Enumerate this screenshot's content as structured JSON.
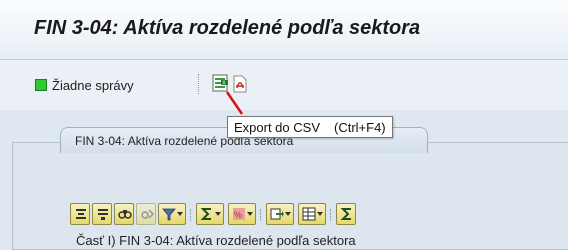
{
  "window": {
    "title": "FIN 3-04: Aktíva rozdelené podľa sektora"
  },
  "toolbar": {
    "status_label": "Žiadne správy",
    "status_color": "#32c832",
    "icons": [
      "export-csv-icon",
      "export-pdf-icon"
    ]
  },
  "tooltip": {
    "label": "Export do CSV",
    "shortcut": "(Ctrl+F4)"
  },
  "tab": {
    "label": "FIN 3-04: Aktíva rozdelené podľa sektora"
  },
  "alv_toolbar": {
    "icons": [
      "sort-ascending-icon",
      "sort-descending-icon",
      "find-icon",
      "find-next-icon",
      "filter-icon",
      "sum-icon",
      "subtotal-icon",
      "print-preview-icon",
      "layout-icon",
      "sum-icon"
    ],
    "accent": "#e6d86a"
  },
  "section": {
    "title": "Časť I) FIN 3-04: Aktíva rozdelené podľa sektora"
  }
}
